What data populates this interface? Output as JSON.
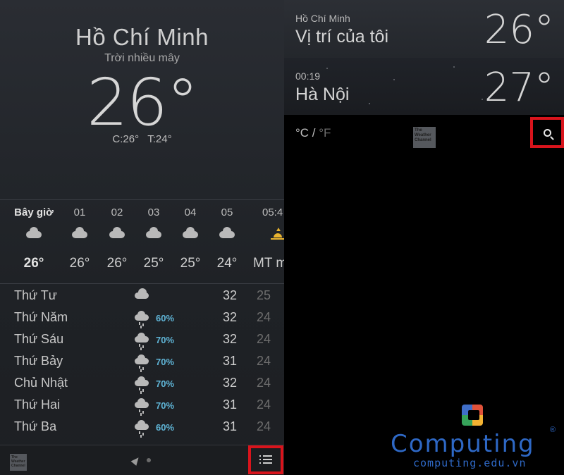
{
  "current": {
    "city": "Hồ Chí Minh",
    "condition": "Trời nhiều mây",
    "temp": "26°",
    "high": "C:26°",
    "low": "T:24°"
  },
  "hourly": [
    {
      "label": "Bây giờ",
      "icon": "cloud-icon",
      "temp": "26°"
    },
    {
      "label": "01",
      "icon": "cloud-icon",
      "temp": "26°"
    },
    {
      "label": "02",
      "icon": "cloud-icon",
      "temp": "26°"
    },
    {
      "label": "03",
      "icon": "cloud-icon",
      "temp": "25°"
    },
    {
      "label": "04",
      "icon": "cloud-icon",
      "temp": "25°"
    },
    {
      "label": "05",
      "icon": "cloud-icon",
      "temp": "24°"
    },
    {
      "label": "05:4",
      "icon": "sunrise-icon",
      "temp": "MT m"
    }
  ],
  "daily": [
    {
      "day": "Thứ Tư",
      "icon": "cloud-icon",
      "chance": "",
      "hi": "32",
      "lo": "25"
    },
    {
      "day": "Thứ Năm",
      "icon": "rain-icon",
      "chance": "60%",
      "hi": "32",
      "lo": "24"
    },
    {
      "day": "Thứ Sáu",
      "icon": "rain-icon",
      "chance": "70%",
      "hi": "32",
      "lo": "24"
    },
    {
      "day": "Thứ Bảy",
      "icon": "rain-icon",
      "chance": "70%",
      "hi": "31",
      "lo": "24"
    },
    {
      "day": "Chủ Nhật",
      "icon": "rain-icon",
      "chance": "70%",
      "hi": "32",
      "lo": "24"
    },
    {
      "day": "Thứ Hai",
      "icon": "rain-icon",
      "chance": "70%",
      "hi": "31",
      "lo": "24"
    },
    {
      "day": "Thứ Ba",
      "icon": "rain-icon",
      "chance": "60%",
      "hi": "31",
      "lo": "24"
    }
  ],
  "bottom_bar": {
    "logo_text": "The Weather Channel"
  },
  "locations": [
    {
      "small": "Hồ Chí Minh",
      "name": "Vị trí của tôi",
      "temp": "26°"
    },
    {
      "small": "00:19",
      "name": "Hà Nội",
      "temp": "27°"
    }
  ],
  "units": {
    "c": "°C",
    "sep": " / ",
    "f": "°F"
  },
  "watermark": {
    "title": "Computing",
    "reg": "®",
    "url": "computing.edu.vn"
  },
  "colors": {
    "highlight": "#d9141c",
    "precip": "#5fb4d6",
    "brand": "#2e68c5"
  }
}
